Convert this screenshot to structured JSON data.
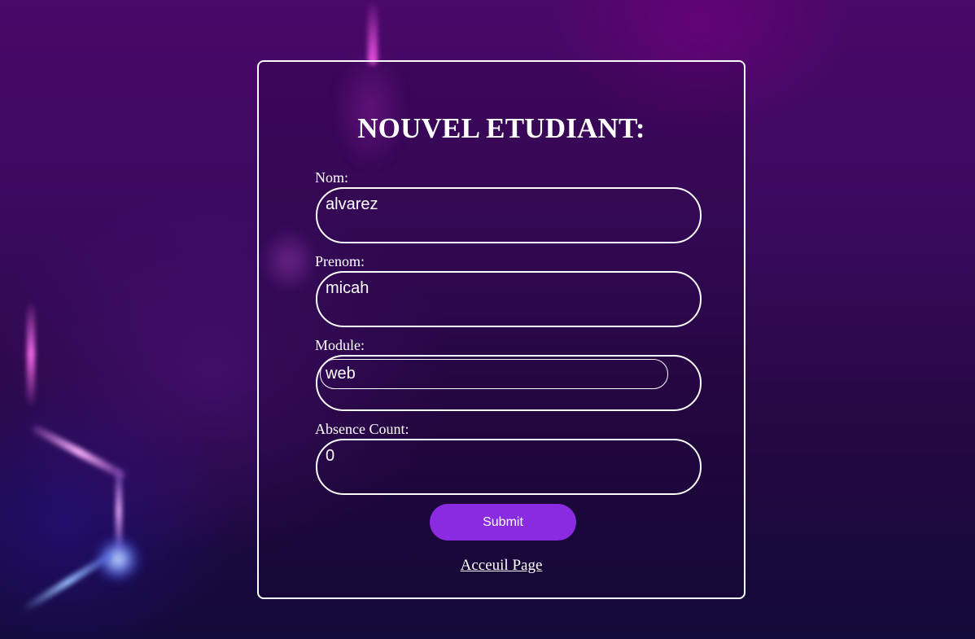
{
  "form": {
    "title": "NOUVEL ETUDIANT:",
    "fields": [
      {
        "label": "Nom:",
        "value": "alvarez"
      },
      {
        "label": "Prenom:",
        "value": "micah"
      },
      {
        "label": "Module:",
        "value": "web"
      },
      {
        "label": "Absence Count:",
        "value": "0"
      }
    ],
    "submit_label": "Submit",
    "home_link_label": "Acceuil Page"
  },
  "colors": {
    "accent": "#8a2be2",
    "border": "#ffffff",
    "text": "#ffffff"
  }
}
